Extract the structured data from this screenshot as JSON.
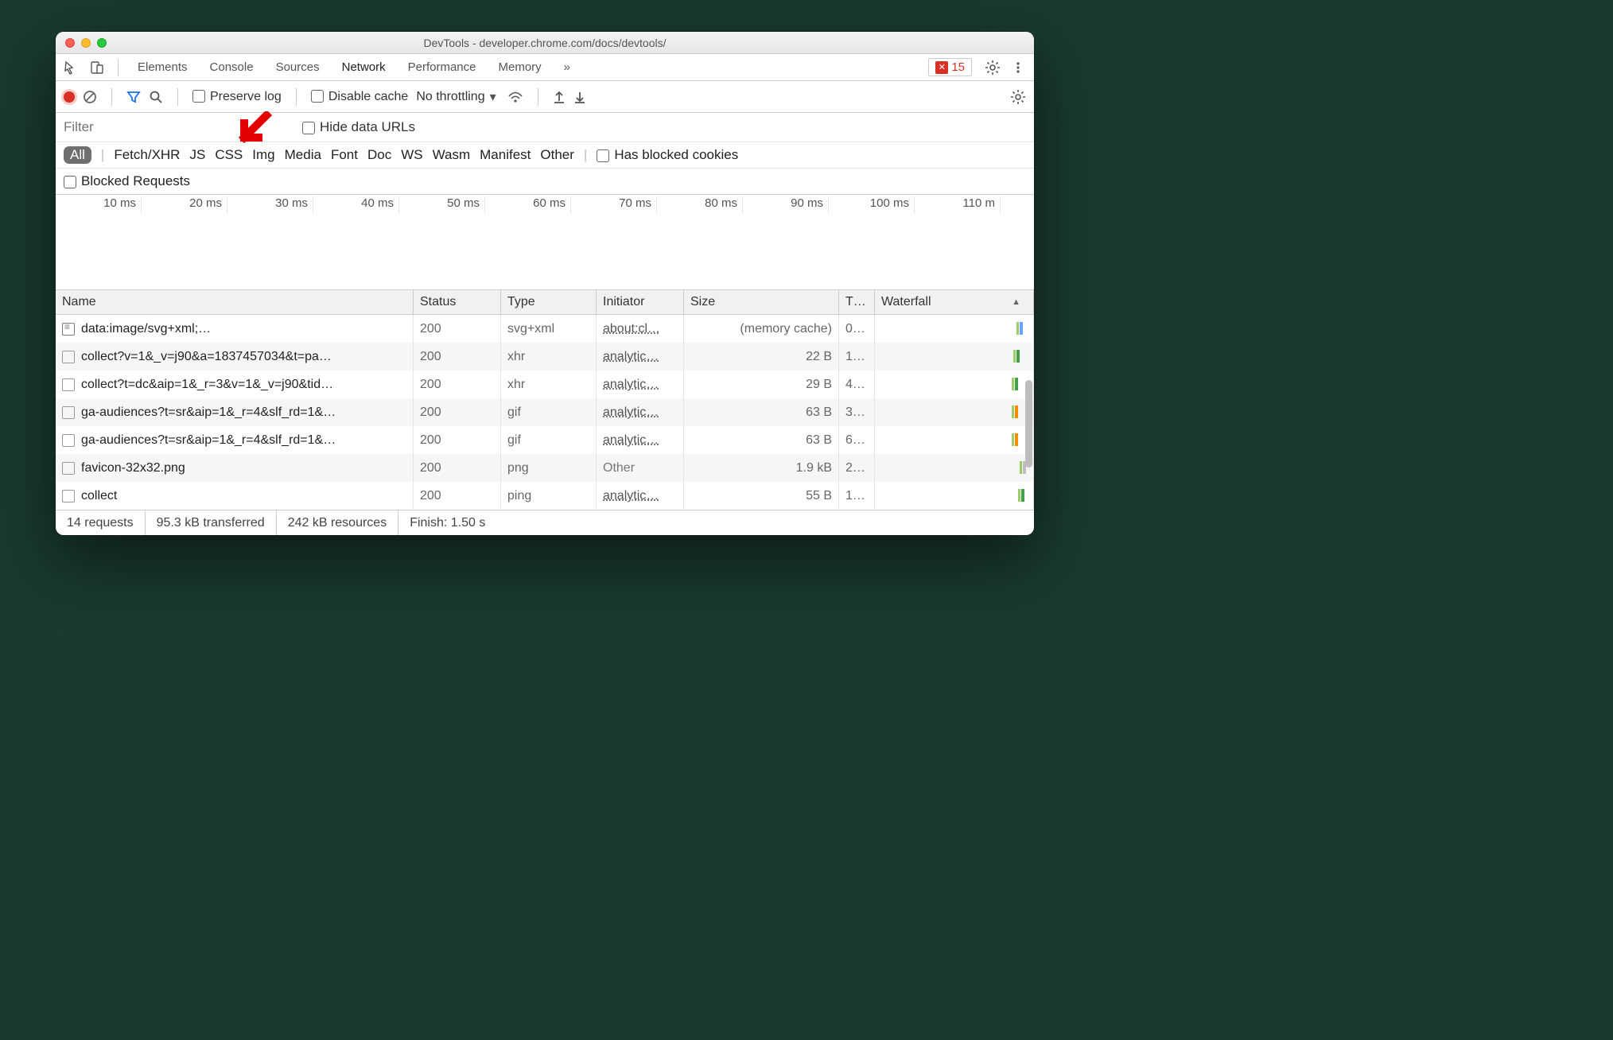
{
  "window": {
    "title": "DevTools - developer.chrome.com/docs/devtools/"
  },
  "tabs": {
    "items": [
      "Elements",
      "Console",
      "Sources",
      "Network",
      "Performance",
      "Memory"
    ],
    "active": "Network",
    "more_icon": "»",
    "error_count": "15"
  },
  "toolbar": {
    "preserve_log": "Preserve log",
    "disable_cache": "Disable cache",
    "throttling": "No throttling"
  },
  "filter": {
    "placeholder": "Filter",
    "hide_data_urls": "Hide data URLs"
  },
  "types": {
    "all": "All",
    "rest": [
      "Fetch/XHR",
      "JS",
      "CSS",
      "Img",
      "Media",
      "Font",
      "Doc",
      "WS",
      "Wasm",
      "Manifest",
      "Other"
    ],
    "has_blocked": "Has blocked cookies",
    "blocked_requests": "Blocked Requests"
  },
  "timeline": {
    "ticks": [
      "10 ms",
      "20 ms",
      "30 ms",
      "40 ms",
      "50 ms",
      "60 ms",
      "70 ms",
      "80 ms",
      "90 ms",
      "100 ms",
      "110 m"
    ]
  },
  "columns": {
    "name": "Name",
    "status": "Status",
    "type": "Type",
    "initiator": "Initiator",
    "size": "Size",
    "time": "T…",
    "waterfall": "Waterfall"
  },
  "rows": [
    {
      "name": "data:image/svg+xml;…",
      "icon": "svg",
      "status": "200",
      "type": "svg+xml",
      "initiator": "about:cl…",
      "init_link": true,
      "size": "(memory cache)",
      "time": "0…",
      "wf_left": "95%",
      "wf_color": "#6aa0ff"
    },
    {
      "name": "collect?v=1&_v=j90&a=1837457034&t=pa…",
      "icon": "file",
      "status": "200",
      "type": "xhr",
      "initiator": "analytic…",
      "init_link": true,
      "size": "22 B",
      "time": "1…",
      "wf_left": "93%",
      "wf_color": "#43a047"
    },
    {
      "name": "collect?t=dc&aip=1&_r=3&v=1&_v=j90&tid…",
      "icon": "file",
      "status": "200",
      "type": "xhr",
      "initiator": "analytic…",
      "init_link": true,
      "size": "29 B",
      "time": "4…",
      "wf_left": "92%",
      "wf_color": "#43a047"
    },
    {
      "name": "ga-audiences?t=sr&aip=1&_r=4&slf_rd=1&…",
      "icon": "file",
      "status": "200",
      "type": "gif",
      "initiator": "analytic…",
      "init_link": true,
      "size": "63 B",
      "time": "3…",
      "wf_left": "92%",
      "wf_color": "#fb8c00"
    },
    {
      "name": "ga-audiences?t=sr&aip=1&_r=4&slf_rd=1&…",
      "icon": "file",
      "status": "200",
      "type": "gif",
      "initiator": "analytic…",
      "init_link": true,
      "size": "63 B",
      "time": "6…",
      "wf_left": "92%",
      "wf_color": "#fb8c00"
    },
    {
      "name": "favicon-32x32.png",
      "icon": "file",
      "status": "200",
      "type": "png",
      "initiator": "Other",
      "init_link": false,
      "size": "1.9 kB",
      "time": "2…",
      "wf_left": "97%",
      "wf_color": "#bdbdbd"
    },
    {
      "name": "collect",
      "icon": "file",
      "status": "200",
      "type": "ping",
      "initiator": "analytic…",
      "init_link": true,
      "size": "55 B",
      "time": "1…",
      "wf_left": "96%",
      "wf_color": "#43a047"
    }
  ],
  "status": {
    "requests": "14 requests",
    "transferred": "95.3 kB transferred",
    "resources": "242 kB resources",
    "finish": "Finish: 1.50 s"
  }
}
